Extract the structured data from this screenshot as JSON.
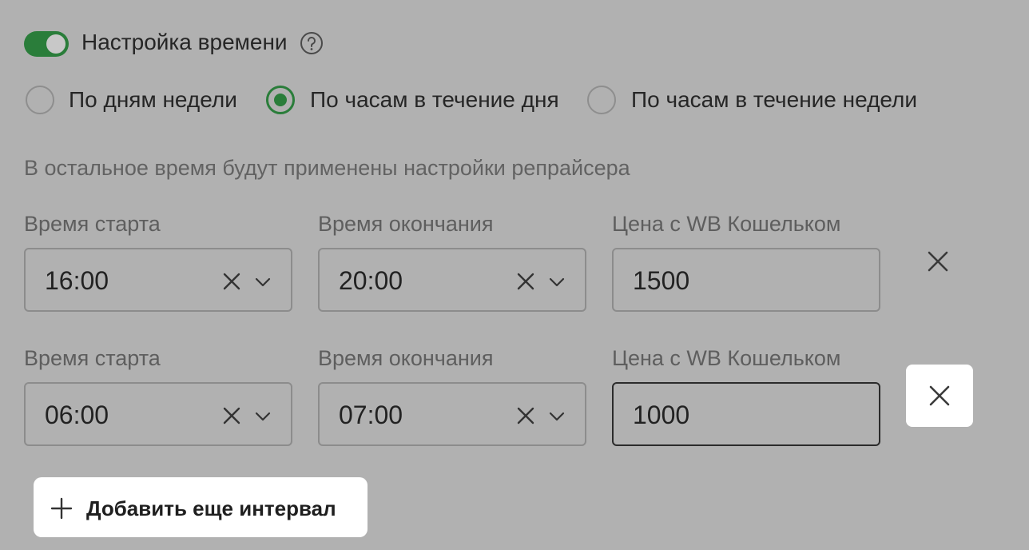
{
  "time_setting": {
    "toggle_on": true,
    "label": "Настройка времени",
    "help_icon": "question-circle-icon"
  },
  "modes": [
    {
      "label": "По дням недели",
      "checked": false
    },
    {
      "label": "По часам в течение дня",
      "checked": true
    },
    {
      "label": "По часам в течение недели",
      "checked": false
    }
  ],
  "hint": "В остальное время будут применены настройки репрайсера",
  "intervals": [
    {
      "start_label": "Время старта",
      "start_value": "16:00",
      "end_label": "Время окончания",
      "end_value": "20:00",
      "price_label": "Цена с WB Кошельком",
      "price_value": "1500"
    },
    {
      "start_label": "Время старта",
      "start_value": "06:00",
      "end_label": "Время окончания",
      "end_value": "07:00",
      "price_label": "Цена с WB Кошельком",
      "price_value": "1000"
    }
  ],
  "add_interval_label": "Добавить еще интервал",
  "colors": {
    "accent": "#2a7d3a",
    "background": "#b1b1b1"
  }
}
